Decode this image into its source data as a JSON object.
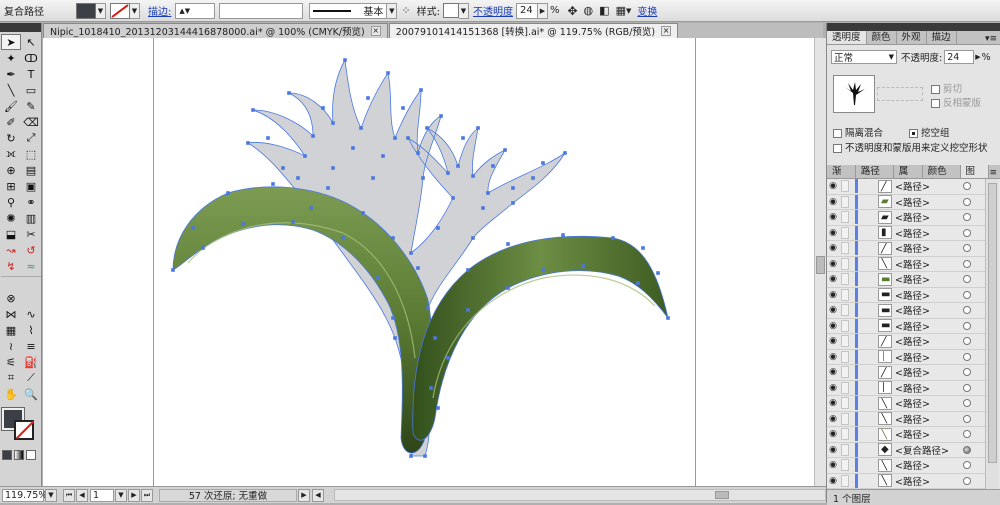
{
  "control_bar": {
    "selection_label": "复合路径",
    "fill_color": "#3c4046",
    "stroke_label": "描边:",
    "stroke_weight": "",
    "stroke_profile": "",
    "brush_label": "基本",
    "style_label": "样式:",
    "opacity_label": "不透明度",
    "opacity_value": "24",
    "percent": "%",
    "transform_link": "变换"
  },
  "doc_tabs": [
    {
      "label": "Nipic_1018410_20131203144416878000.ai* @ 100% (CMYK/预览)",
      "close": "×"
    },
    {
      "label": "20079101414151368 [转换].ai* @ 119.75% (RGB/预览)",
      "close": "×"
    }
  ],
  "panel_top": {
    "tabs": [
      "透明度",
      "颜色",
      "外观",
      "描边"
    ],
    "menu": "▾≡",
    "blend_mode": "正常",
    "opacity_label": "不透明度:",
    "opacity_value": "24",
    "percent": "%",
    "clip_label": "剪切",
    "invert_mask_label": "反相蒙版",
    "isolate_label": "隔离混合",
    "knockout_label": "挖空组",
    "opacity_mask_label": "不透明度和蒙版用来定义挖空形状"
  },
  "panel_layers": {
    "tabs": [
      "渐变",
      "路径查",
      "属性",
      "颜色参",
      "图层"
    ],
    "row_name": "<路径>",
    "compound_name": "<复合路径>",
    "rows": [
      "<路径>",
      "<路径>",
      "<路径>",
      "<路径>",
      "<路径>",
      "<路径>",
      "<路径>",
      "<路径>",
      "<路径>",
      "<路径>",
      "<路径>",
      "<路径>",
      "<路径>",
      "<路径>",
      "<路径>",
      "<路径>",
      "<路径>",
      "<复合路径>",
      "<路径>",
      "<路径>",
      "<路径>"
    ],
    "footer": "1 个图层"
  },
  "status_bar": {
    "zoom": "119.75%",
    "page": "1",
    "history": "57 次还原; 无重做"
  },
  "colors": {
    "accent_anchor": "#4a78e0",
    "leaf_dark": "#3f5a23",
    "leaf_light": "#7a9a4d",
    "flower_gray": "#d0d2d6"
  }
}
